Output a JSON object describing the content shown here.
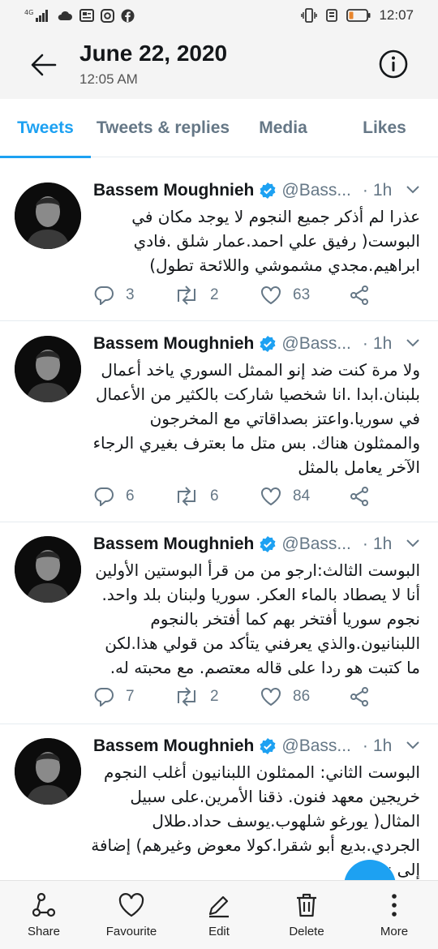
{
  "status_bar": {
    "network": "4G",
    "time": "12:07",
    "icons": [
      "signal-icon",
      "cloud-icon",
      "news-icon",
      "instagram-icon",
      "facebook-icon",
      "vibrate-icon",
      "alarm-icon",
      "battery-icon"
    ]
  },
  "header": {
    "title": "June 22, 2020",
    "subtitle": "12:05 AM",
    "back_icon": "arrow-left-icon",
    "info_icon": "info-icon"
  },
  "tabs": [
    {
      "label": "Tweets",
      "active": true
    },
    {
      "label": "Tweets & replies",
      "active": false
    },
    {
      "label": "Media",
      "active": false
    },
    {
      "label": "Likes",
      "active": false
    }
  ],
  "colors": {
    "accent": "#1da1f2",
    "muted": "#657786",
    "text": "#14171a"
  },
  "tweets": [
    {
      "name": "Bassem Moughnieh",
      "handle": "@Bass...",
      "time": "1h",
      "text": "عذرا لم أذكر جميع النجوم لا يوجد مكان في البوست( رفيق علي احمد.عمار شلق .فادي ابراهيم.مجدي مشموشي واللائحة تطول)",
      "replies": "3",
      "retweets": "2",
      "likes": "63"
    },
    {
      "name": "Bassem Moughnieh",
      "handle": "@Bass...",
      "time": "1h",
      "text": "ولا مرة كنت ضد إنو الممثل السوري ياخد أعمال بلبنان.ابدا .انا شخصيا شاركت بالكثير من الأعمال في سوريا.واعتز بصداقاتي مع المخرجون والممثلون هناك. بس متل ما بعترف بغيري الرجاء الآخر يعامل بالمثل",
      "replies": "6",
      "retweets": "6",
      "likes": "84"
    },
    {
      "name": "Bassem Moughnieh",
      "handle": "@Bass...",
      "time": "1h",
      "text": "البوست الثالث:ارجو من من قرأ البوستين الأولين أنا لا يصطاد بالماء العكر. سوريا ولبنان بلد واحد. نجوم سوريا أفتخر بهم كما أفتخر بالنجوم اللبنانيون.والذي يعرفني يتأكد من قولي هذا.لكن ما كتبت هو ردا على قاله معتصم. مع محبته له.",
      "replies": "7",
      "retweets": "2",
      "likes": "86"
    },
    {
      "name": "Bassem Moughnieh",
      "handle": "@Bass...",
      "time": "1h",
      "text": "البوست الثاني: الممثلون اللبنانيون أغلب النجوم خريجين معهد فنون. ذقنا الأمرين.على سبيل المثال( يورغو شلهوب.يوسف حداد.طلال الجردي.بديع أبو شقرا.كولا معوض وغيرهم) إضافة إلى نجوم"
    }
  ],
  "bottom_bar": [
    {
      "label": "Share",
      "icon": "share-icon"
    },
    {
      "label": "Favourite",
      "icon": "heart-icon"
    },
    {
      "label": "Edit",
      "icon": "pencil-icon"
    },
    {
      "label": "Delete",
      "icon": "trash-icon"
    },
    {
      "label": "More",
      "icon": "more-vertical-icon"
    }
  ]
}
